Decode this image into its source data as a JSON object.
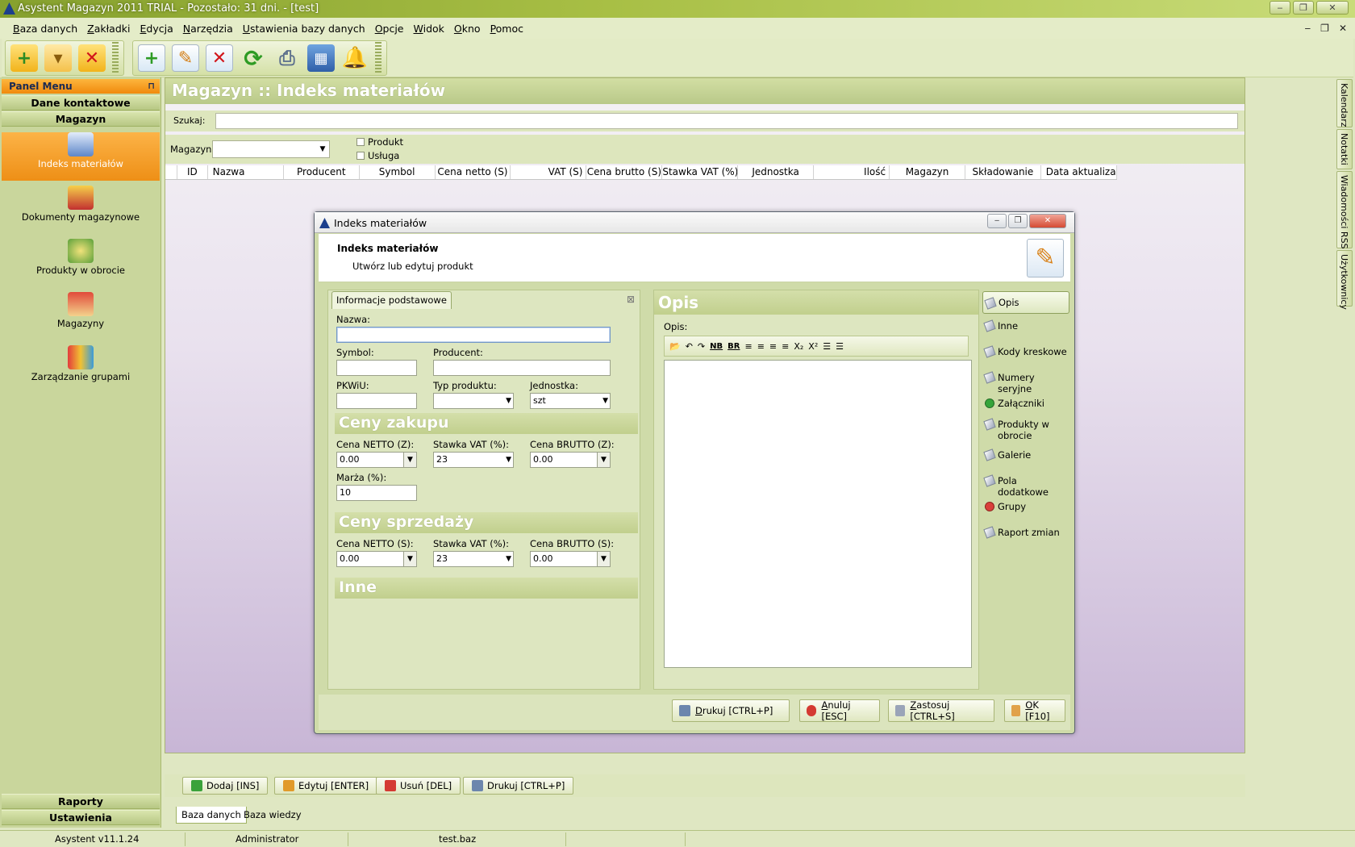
{
  "window": {
    "title": "Asystent Magazyn 2011 TRIAL - Pozostało: 31 dni. - [test]",
    "controls": [
      "‒",
      "❐",
      "✕"
    ]
  },
  "menu": [
    "Baza danych",
    "Zakładki",
    "Edycja",
    "Narzędzia",
    "Ustawienia bazy danych",
    "Opcje",
    "Widok",
    "Okno",
    "Pomoc"
  ],
  "mdi_controls": [
    "‒",
    "❐",
    "✕"
  ],
  "toolbar": {
    "icons": [
      "new-db-icon",
      "open-folder-icon",
      "close-db-icon",
      "add-document-icon",
      "edit-document-icon",
      "delete-document-icon",
      "refresh-icon",
      "print-icon",
      "calculator-icon",
      "bell-icon"
    ]
  },
  "panel": {
    "header": "Panel Menu",
    "pin": "⊓",
    "sections": {
      "contacts": "Dane kontaktowe",
      "warehouse": "Magazyn",
      "reports": "Raporty",
      "settings": "Ustawienia"
    },
    "items": [
      {
        "label": "Indeks materiałów",
        "icon": "book-icon",
        "active": true
      },
      {
        "label": "Dokumenty magazynowe",
        "icon": "documents-icon",
        "active": false
      },
      {
        "label": "Produkty w obrocie",
        "icon": "cycle-icon",
        "active": false
      },
      {
        "label": "Magazyny",
        "icon": "warehouse-icon",
        "active": false
      },
      {
        "label": "Zarządzanie grupami",
        "icon": "database-icon",
        "active": false
      }
    ]
  },
  "main": {
    "title": "Magazyn :: Indeks materiałów",
    "search_label": "Szukaj:",
    "search_value": "",
    "warehouse_label": "Magazyn:",
    "warehouse_value": "",
    "filters": {
      "product": "Produkt",
      "service": "Usługa"
    },
    "columns": [
      "",
      "ID",
      "Nazwa",
      "Producent",
      "Symbol",
      "Cena netto (S)",
      "VAT (S)",
      "Cena brutto (S)",
      "Stawka VAT (%)",
      "Jednostka",
      "Ilość",
      "Magazyn",
      "Składowanie",
      "Data aktualiza..."
    ]
  },
  "right_tabs": [
    "Kalendarz",
    "Notatki",
    "Wiadomości RSS",
    "Użytkownicy"
  ],
  "bottom_buttons": [
    "Dodaj [INS]",
    "Edytuj [ENTER]",
    "Usuń [DEL]",
    "Drukuj [CTRL+P]"
  ],
  "bottom_tabs": [
    "Baza danych",
    "Baza wiedzy"
  ],
  "status": [
    "Asystent v11.1.24",
    "Administrator",
    "test.baz"
  ],
  "dialog": {
    "title": "Indeks materiałów",
    "header_title": "Indeks materiałów",
    "header_subtitle": "Utwórz lub edytuj produkt",
    "tab": "Informacje podstawowe",
    "tab_close": "⊠",
    "fields": {
      "name_label": "Nazwa:",
      "name_value": "",
      "symbol_label": "Symbol:",
      "symbol_value": "",
      "producer_label": "Producent:",
      "producer_value": "",
      "pkwiu_label": "PKWiU:",
      "pkwiu_value": "",
      "type_label": "Typ produktu:",
      "type_value": "",
      "unit_label": "Jednostka:",
      "unit_value": "szt"
    },
    "purchase": {
      "header": "Ceny zakupu",
      "net_label": "Cena NETTO (Z):",
      "net_value": "0.00",
      "vat_label": "Stawka VAT (%):",
      "vat_value": "23",
      "gross_label": "Cena BRUTTO (Z):",
      "gross_value": "0.00",
      "margin_label": "Marża (%):",
      "margin_value": "10"
    },
    "sale": {
      "header": "Ceny sprzedaży",
      "net_label": "Cena NETTO (S):",
      "net_value": "0.00",
      "vat_label": "Stawka VAT (%):",
      "vat_value": "23",
      "gross_label": "Cena BRUTTO (S):",
      "gross_value": "0.00"
    },
    "other_header": "Inne",
    "description": {
      "header": "Opis",
      "label": "Opis:",
      "toolbar": [
        "📂",
        "↶",
        "↷",
        "NB",
        "BR",
        "≡",
        "≡",
        "≡",
        "≡",
        "X₂",
        "X²",
        "☰",
        "☰"
      ],
      "value": ""
    },
    "side_nav": [
      "Opis",
      "Inne",
      "Kody kreskowe",
      "Numery seryjne",
      "Załączniki",
      "Produkty w obrocie",
      "Galerie",
      "Pola dodatkowe",
      "Grupy",
      "Raport zmian"
    ],
    "buttons": [
      "Drukuj [CTRL+P]",
      "Anuluj [ESC]",
      "Zastosuj [CTRL+S]",
      "OK [F10]"
    ]
  }
}
